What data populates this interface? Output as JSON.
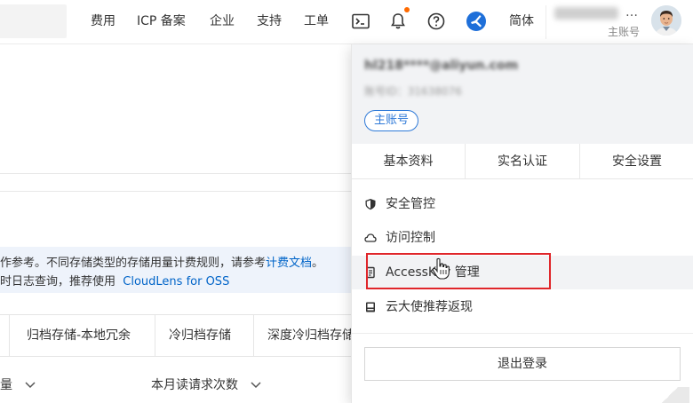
{
  "topbar": {
    "nav": [
      "费用",
      "ICP 备案",
      "企业",
      "支持",
      "工单"
    ],
    "lang_label": "简体",
    "account_name": "hl218****@aliyun.com",
    "account_ellipsis": "…",
    "account_role": "主账号",
    "icons": [
      "terminal-icon",
      "bell-icon",
      "help-icon",
      "app-logo-icon"
    ],
    "notification_dot_color": "#ff6a00"
  },
  "background": {
    "info_line_1": "作参考。不同存储类型的存储用量计费规则，请参考",
    "info_link_1": "计费文档",
    "info_line_1_tail": "。",
    "info_line_2": "时日志查询，推荐使用",
    "info_link_2": "CloudLens for OSS",
    "tabs": [
      "归档存储-本地冗余",
      "冷归档存储",
      "深度冷归档存储"
    ],
    "col_heads": [
      "量",
      "本月读请求次数"
    ]
  },
  "panel": {
    "email": "hl218****@aliyun.com",
    "account_id_label": "账号ID：31638076",
    "role_badge": "主账号",
    "quick_links": [
      "基本资料",
      "实名认证",
      "安全设置"
    ],
    "menu": [
      {
        "label": "安全管控",
        "icon": "shield-icon"
      },
      {
        "label": "访问控制",
        "icon": "cloud-icon"
      },
      {
        "label": "AccessKey 管理",
        "icon": "key-icon"
      },
      {
        "label": "云大使推荐返现",
        "icon": "ambassador-icon"
      }
    ],
    "logout_label": "退出登录"
  },
  "colors": {
    "accent": "#2f7ad8",
    "link": "#0064c8",
    "highlight": "#e0262a"
  }
}
